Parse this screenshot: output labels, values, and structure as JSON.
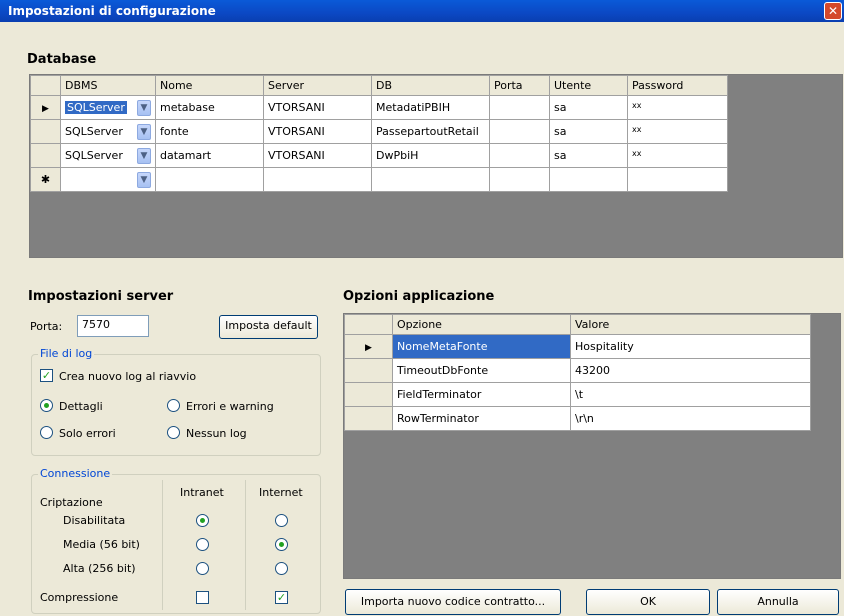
{
  "window": {
    "title": "Impostazioni di configurazione",
    "close_glyph": "✕"
  },
  "database": {
    "section_title": "Database",
    "columns": [
      "DBMS",
      "Nome",
      "Server",
      "DB",
      "Porta",
      "Utente",
      "Password"
    ],
    "rows": [
      {
        "dbms": "SQLServer",
        "nome": "metabase",
        "server": "VTORSANI",
        "db": "MetadatiPBIH",
        "porta": "",
        "utente": "sa",
        "password": "xx"
      },
      {
        "dbms": "SQLServer",
        "nome": "fonte",
        "server": "VTORSANI",
        "db": "PassepartoutRetail",
        "porta": "",
        "utente": "sa",
        "password": "xx"
      },
      {
        "dbms": "SQLServer",
        "nome": "datamart",
        "server": "VTORSANI",
        "db": "DwPbiH",
        "porta": "",
        "utente": "sa",
        "password": "xx"
      }
    ],
    "current_row_glyph": "▶",
    "new_row_glyph": "✱",
    "combo_arrow": "▼"
  },
  "server": {
    "section_title": "Impostazioni server",
    "porta_label": "Porta:",
    "porta_value": "7570",
    "default_button": "Imposta default",
    "log_group": "File di log",
    "new_log_label": "Crea nuovo log al riavvio",
    "new_log_checked": true,
    "log_options": [
      "Dettagli",
      "Errori e warning",
      "Solo errori",
      "Nessun log"
    ],
    "log_selected": "Dettagli",
    "conn_group": "Connessione",
    "col_intranet": "Intranet",
    "col_internet": "Internet",
    "cript_label": "Criptazione",
    "cript_rows": [
      "Disabilitata",
      "Media (56 bit)",
      "Alta (256 bit)"
    ],
    "intranet_selected": "Disabilitata",
    "internet_selected": "Media (56 bit)",
    "compression_label": "Compressione",
    "compression_intranet": false,
    "compression_internet": true,
    "check_glyph": "✓"
  },
  "options": {
    "section_title": "Opzioni applicazione",
    "columns": [
      "Opzione",
      "Valore"
    ],
    "rows": [
      {
        "opzione": "NomeMetaFonte",
        "valore": "Hospitality"
      },
      {
        "opzione": "TimeoutDbFonte",
        "valore": "43200"
      },
      {
        "opzione": "FieldTerminator",
        "valore": "\\t"
      },
      {
        "opzione": "RowTerminator",
        "valore": "\\r\\n"
      }
    ]
  },
  "buttons": {
    "import": "Importa nuovo codice contratto...",
    "ok": "OK",
    "cancel": "Annulla"
  }
}
